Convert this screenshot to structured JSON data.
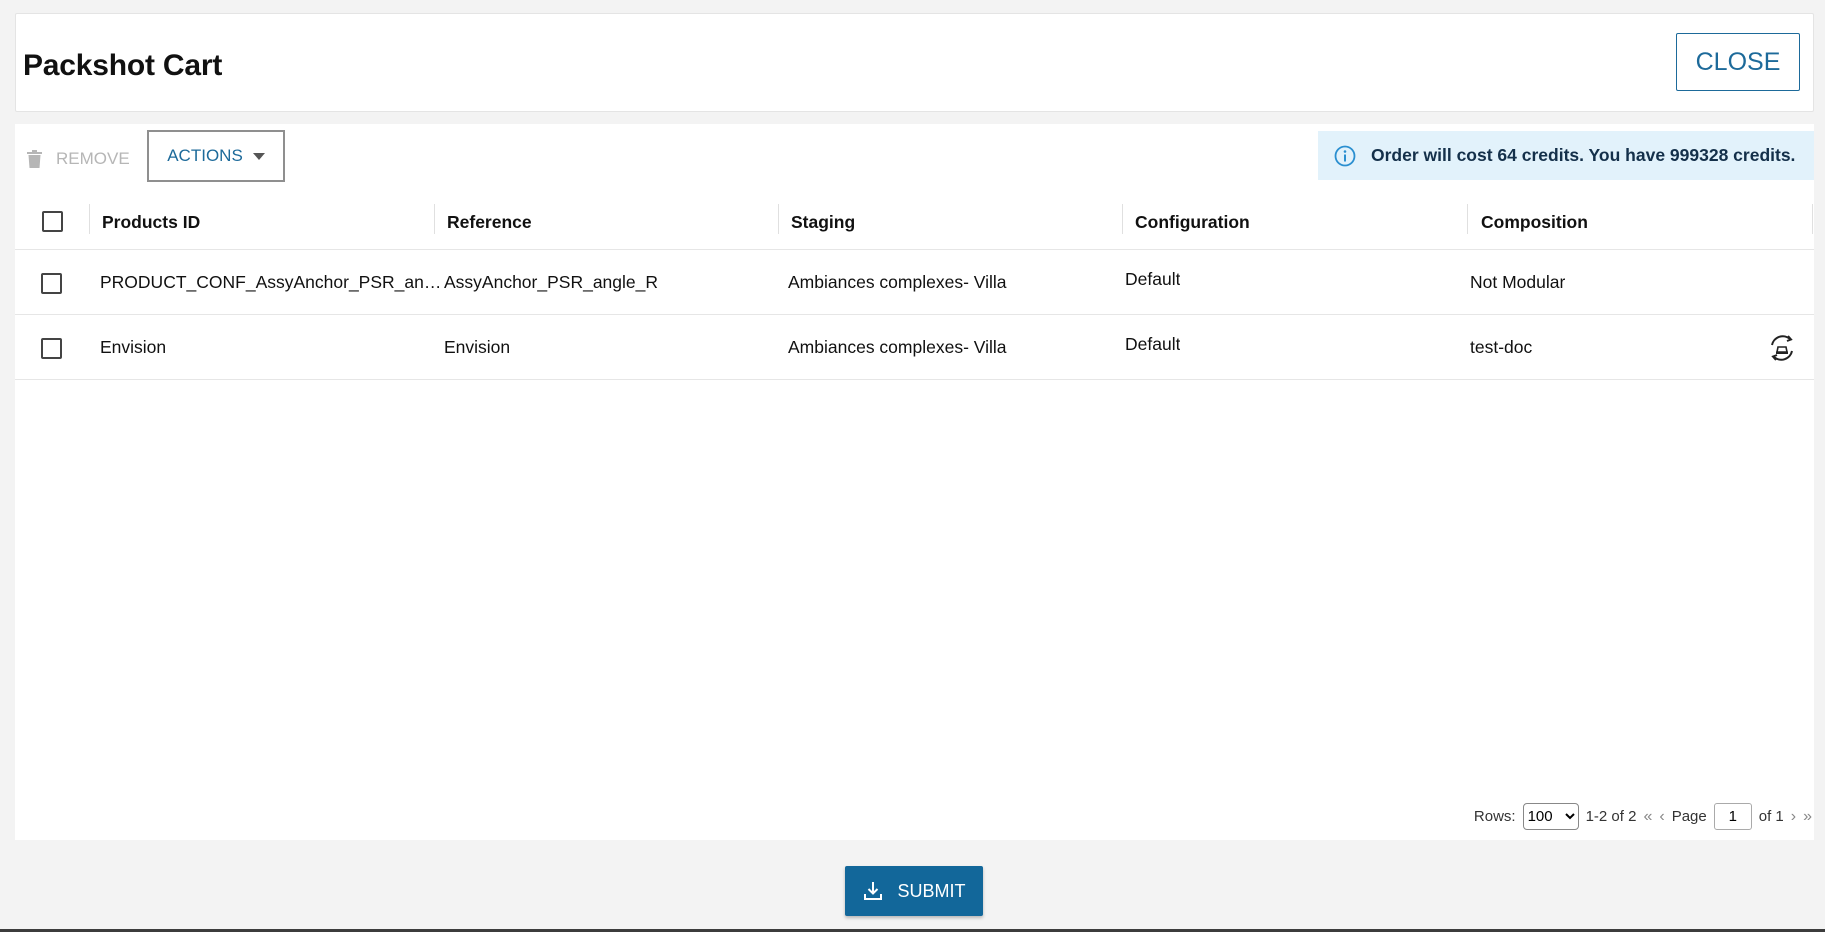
{
  "header": {
    "title": "Packshot Cart",
    "close_label": "CLOSE"
  },
  "toolbar": {
    "remove_label": "REMOVE",
    "actions_label": "ACTIONS",
    "info_text": "Order will cost 64 credits. You have 999328 credits."
  },
  "table": {
    "columns": [
      "Products ID",
      "Reference",
      "Staging",
      "Configuration",
      "Composition"
    ],
    "rows": [
      {
        "product_id": "PRODUCT_CONF_AssyAnchor_PSR_angle_R",
        "reference": "AssyAnchor_PSR_angle_R",
        "staging": "Ambiances complexes- Villa",
        "configuration": "Default",
        "composition": "Not Modular"
      },
      {
        "product_id": "Envision",
        "reference": "Envision",
        "staging": "Ambiances complexes- Villa",
        "configuration": "Default",
        "composition": "test-doc"
      }
    ]
  },
  "pager": {
    "rows_label": "Rows:",
    "rows_value": "100",
    "range": "1-2 of 2",
    "page_label": "Page",
    "page_value": "1",
    "of_label": "of 1"
  },
  "footer": {
    "submit_label": "SUBMIT"
  },
  "colors": {
    "primary": "#12679a",
    "info_bg": "#e2f2fb",
    "accent_text": "#1d6a9a"
  }
}
